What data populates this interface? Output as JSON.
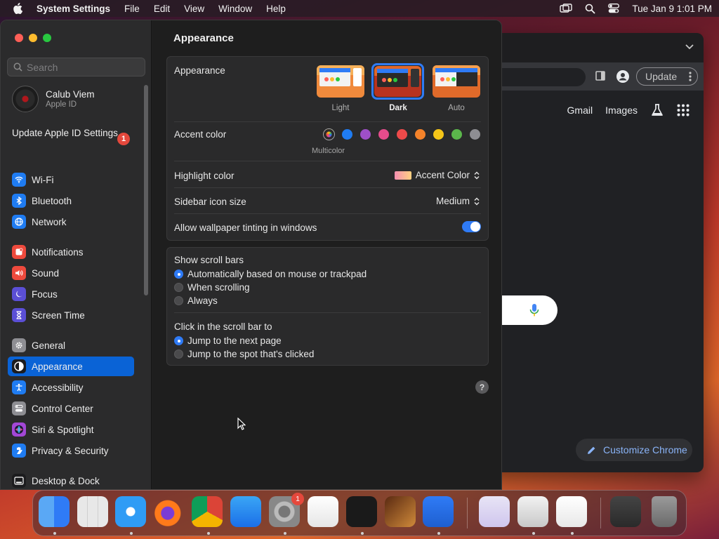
{
  "menubar": {
    "app_name": "System Settings",
    "menus": [
      "File",
      "Edit",
      "View",
      "Window",
      "Help"
    ],
    "clock": "Tue Jan 9  1:01 PM",
    "icons": [
      "apple-logo-icon",
      "screen-mirroring-icon",
      "spotlight-search-icon",
      "control-center-icon"
    ]
  },
  "chrome": {
    "update_label": "Update",
    "links": {
      "gmail": "Gmail",
      "images": "Images"
    },
    "customize_label": "Customize Chrome"
  },
  "sidebar": {
    "search_placeholder": "Search",
    "account": {
      "name": "Calub Viem",
      "subtitle": "Apple ID"
    },
    "update_apple_id": "Update Apple ID Settings",
    "update_badge": "1",
    "groups": [
      [
        {
          "label": "Wi-Fi",
          "icon": "wifi-icon",
          "color": "#1f7cf2"
        },
        {
          "label": "Bluetooth",
          "icon": "bluetooth-icon",
          "color": "#1f7cf2"
        },
        {
          "label": "Network",
          "icon": "globe-icon",
          "color": "#1f7cf2"
        }
      ],
      [
        {
          "label": "Notifications",
          "icon": "bell-icon",
          "color": "#ee4a3d"
        },
        {
          "label": "Sound",
          "icon": "speaker-icon",
          "color": "#ee4a3d"
        },
        {
          "label": "Focus",
          "icon": "moon-icon",
          "color": "#5b4fd6"
        },
        {
          "label": "Screen Time",
          "icon": "hourglass-icon",
          "color": "#5b4fd6"
        }
      ],
      [
        {
          "label": "General",
          "icon": "gear-icon",
          "color": "#8e8e93"
        },
        {
          "label": "Appearance",
          "icon": "appearance-icon",
          "color": "#1c1c1e",
          "active": true
        },
        {
          "label": "Accessibility",
          "icon": "accessibility-icon",
          "color": "#1f7cf2"
        },
        {
          "label": "Control Center",
          "icon": "control-center-icon",
          "color": "#8e8e93"
        },
        {
          "label": "Siri & Spotlight",
          "icon": "siri-icon",
          "color": "#a347d6"
        },
        {
          "label": "Privacy & Security",
          "icon": "hand-icon",
          "color": "#1f7cf2"
        }
      ],
      [
        {
          "label": "Desktop & Dock",
          "icon": "dock-icon",
          "color": "#1c1c1e"
        }
      ]
    ]
  },
  "main": {
    "title": "Appearance",
    "appearance": {
      "label": "Appearance",
      "options": [
        {
          "label": "Light",
          "selected": false
        },
        {
          "label": "Dark",
          "selected": true
        },
        {
          "label": "Auto",
          "selected": false
        }
      ]
    },
    "accent": {
      "label": "Accent color",
      "selected_label": "Multicolor",
      "colors": [
        "multicolor",
        "#1f7cf2",
        "#9e4fc7",
        "#e54c8c",
        "#ee4a4a",
        "#f5832a",
        "#f5c518",
        "#5bb74b",
        "#8e8e93"
      ]
    },
    "highlight": {
      "label": "Highlight color",
      "value": "Accent Color"
    },
    "sidebar_icon_size": {
      "label": "Sidebar icon size",
      "value": "Medium"
    },
    "wallpaper_tinting": {
      "label": "Allow wallpaper tinting in windows",
      "enabled": true
    },
    "scroll_bars": {
      "label": "Show scroll bars",
      "options": [
        {
          "label": "Automatically based on mouse or trackpad",
          "selected": true
        },
        {
          "label": "When scrolling",
          "selected": false
        },
        {
          "label": "Always",
          "selected": false
        }
      ]
    },
    "click_scroll": {
      "label": "Click in the scroll bar to",
      "options": [
        {
          "label": "Jump to the next page",
          "selected": true
        },
        {
          "label": "Jump to the spot that's clicked",
          "selected": false
        }
      ]
    },
    "help_label": "?"
  },
  "dock": {
    "badge": "1",
    "apps": [
      "finder-icon",
      "launchpad-icon",
      "safari-icon",
      "firefox-icon",
      "chrome-icon",
      "app-store-icon",
      "system-settings-icon",
      "textedit-icon",
      "terminal-icon",
      "garageband-icon",
      "vscode-icon",
      "visual-studio-icon",
      "disk-utility-icon",
      "freeform-icon",
      "screenshot-icon",
      "trash-icon"
    ]
  }
}
